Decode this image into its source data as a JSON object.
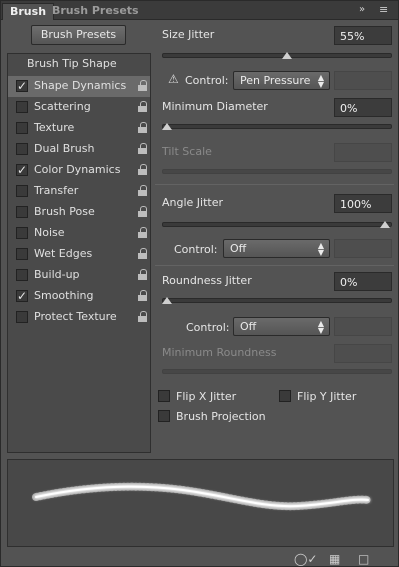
{
  "tabs": [
    {
      "label": "Brush"
    },
    {
      "label": "Brush Presets"
    }
  ],
  "toolbar": {
    "double_arrow_icon": "»",
    "menu_icon": "≡"
  },
  "left": {
    "brush_presets_button": "Brush Presets",
    "tip_heading": "Brush Tip Shape",
    "items": [
      {
        "label": "Shape Dynamics",
        "checked": true
      },
      {
        "label": "Scattering",
        "checked": false
      },
      {
        "label": "Texture",
        "checked": false
      },
      {
        "label": "Dual Brush",
        "checked": false
      },
      {
        "label": "Color Dynamics",
        "checked": true
      },
      {
        "label": "Transfer",
        "checked": false
      },
      {
        "label": "Brush Pose",
        "checked": false
      },
      {
        "label": "Noise",
        "checked": false
      },
      {
        "label": "Wet Edges",
        "checked": false
      },
      {
        "label": "Build-up",
        "checked": false
      },
      {
        "label": "Smoothing",
        "checked": true
      },
      {
        "label": "Protect Texture",
        "checked": false
      }
    ]
  },
  "right": {
    "size_jitter": {
      "label": "Size Jitter",
      "value": "55%",
      "slider_level": 0.55
    },
    "control1": {
      "label": "Control:",
      "value": "Pen Pressure"
    },
    "min_diameter": {
      "label": "Minimum Diameter",
      "value": "0%",
      "slider_level": 0
    },
    "tilt_scale": {
      "label": "Tilt Scale"
    },
    "angle_jitter": {
      "label": "Angle Jitter",
      "value": "100%",
      "slider_level": 1
    },
    "control2": {
      "label": "Control:",
      "value": "Off"
    },
    "roundness_jitter": {
      "label": "Roundness Jitter",
      "value": "0%",
      "slider_level": 0
    },
    "control3": {
      "label": "Control:",
      "value": "Off"
    },
    "min_roundness": {
      "label": "Minimum Roundness"
    },
    "flip_x": {
      "label": "Flip X Jitter"
    },
    "flip_y": {
      "label": "Flip Y Jitter"
    },
    "brush_projection": {
      "label": "Brush Projection"
    }
  },
  "colors": {
    "panel_bg": "#535353",
    "selected_row": "#6a6a6a"
  }
}
